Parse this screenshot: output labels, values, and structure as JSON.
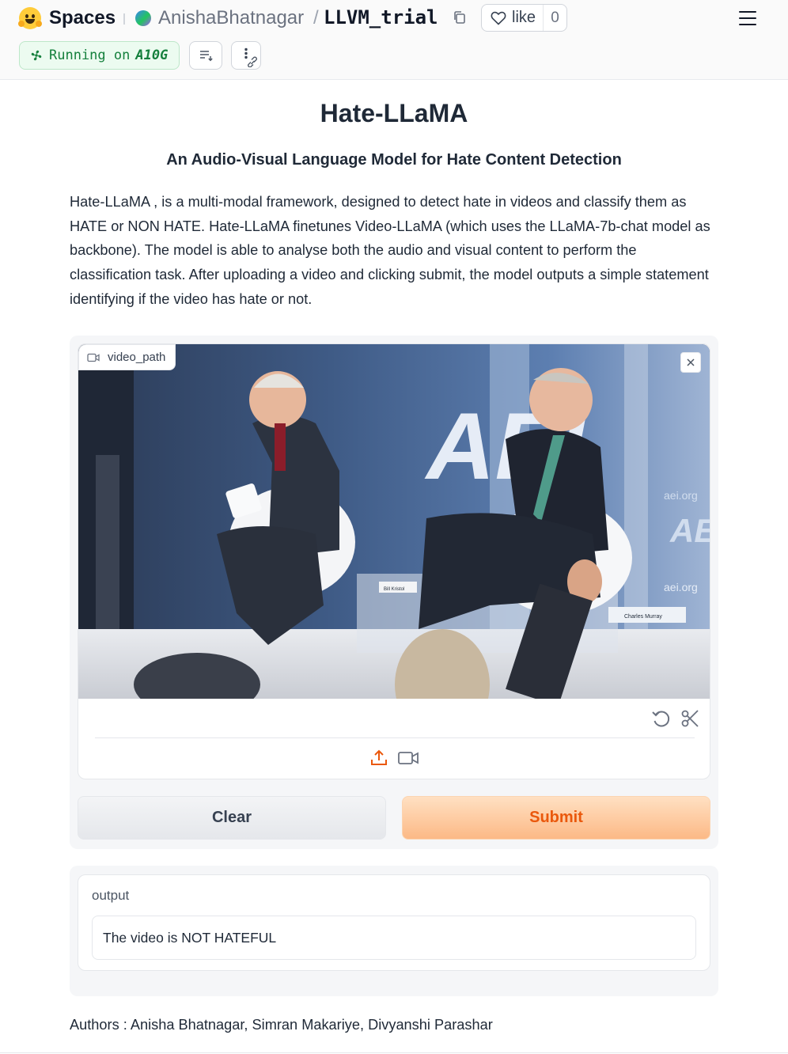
{
  "header": {
    "brand": "Spaces",
    "owner": "AnishaBhatnagar",
    "separator": "/",
    "repo": "LLVM_trial",
    "like_label": "like",
    "like_count": "0",
    "status_prefix": "Running on",
    "hardware": "A10G"
  },
  "app": {
    "title": "Hate-LLaMA",
    "subtitle": "An Audio-Visual Language Model for Hate Content Detection",
    "description": "Hate-LLaMA , is a multi-modal framework, designed to detect hate in videos and classify them as HATE or NON HATE. Hate-LLaMA finetunes Video-LLaMA (which uses the LLaMA-7b-chat model as backbone). The model is able to analyse both the audio and visual content to perform the classification task. After uploading a video and clicking submit, the model outputs a simple statement identifying if the video has hate or not."
  },
  "video_input": {
    "label": "video_path",
    "backdrop_logo": "AEI",
    "backdrop_site": "aei.org",
    "nameplate_left": "Bill Kristol",
    "nameplate_right": "Charles Murray"
  },
  "buttons": {
    "clear": "Clear",
    "submit": "Submit"
  },
  "output": {
    "label": "output",
    "value": "The video is NOT HATEFUL"
  },
  "footer": {
    "authors": "Authors : Anisha Bhatnagar, Simran Makariye, Divyanshi Parashar"
  },
  "colors": {
    "accent": "#ea580c",
    "running_green": "#15803d"
  },
  "icons": {
    "logo": "hugging-face-logo",
    "copy": "copy-icon",
    "like": "heart-icon",
    "menu": "hamburger-menu-icon",
    "video": "video-camera-icon",
    "close": "close-icon",
    "undo": "undo-icon",
    "trim": "scissors-icon",
    "upload": "upload-icon",
    "webcam": "webcam-icon"
  }
}
